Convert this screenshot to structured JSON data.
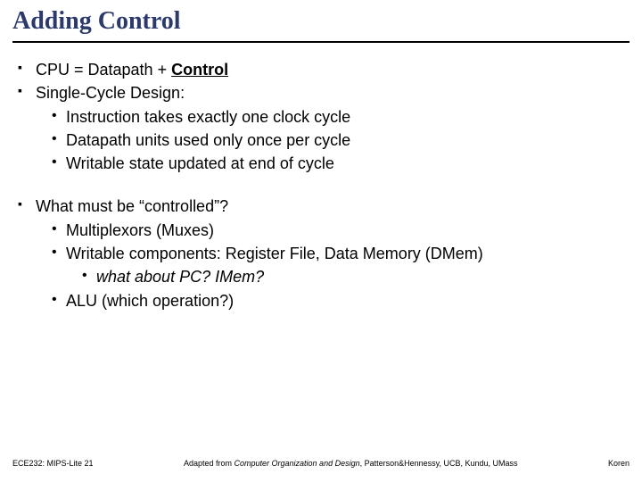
{
  "title": "Adding Control",
  "body": {
    "0": {
      "pre": "CPU = Datapath + ",
      "emph": "Control"
    },
    "1": {
      "text": "Single-Cycle Design:",
      "sub": {
        "0": "Instruction takes exactly one clock cycle",
        "1": "Datapath units used only once per cycle",
        "2": "Writable state updated at end of cycle"
      }
    },
    "2": {
      "text": "What must be “controlled”?",
      "sub": {
        "0": "Multiplexors (Muxes)",
        "1": "Writable components: Register File, Data Memory (DMem)",
        "2": "ALU (which operation?)"
      },
      "sub2": {
        "0": "what about PC?  IMem?"
      }
    }
  },
  "footer": {
    "left": "ECE232: MIPS-Lite 21",
    "center_pre": "Adapted from ",
    "center_src": "Computer Organization and Design",
    "center_post": ", Patterson&Hennessy, UCB, Kundu, UMass",
    "right": "Koren"
  }
}
